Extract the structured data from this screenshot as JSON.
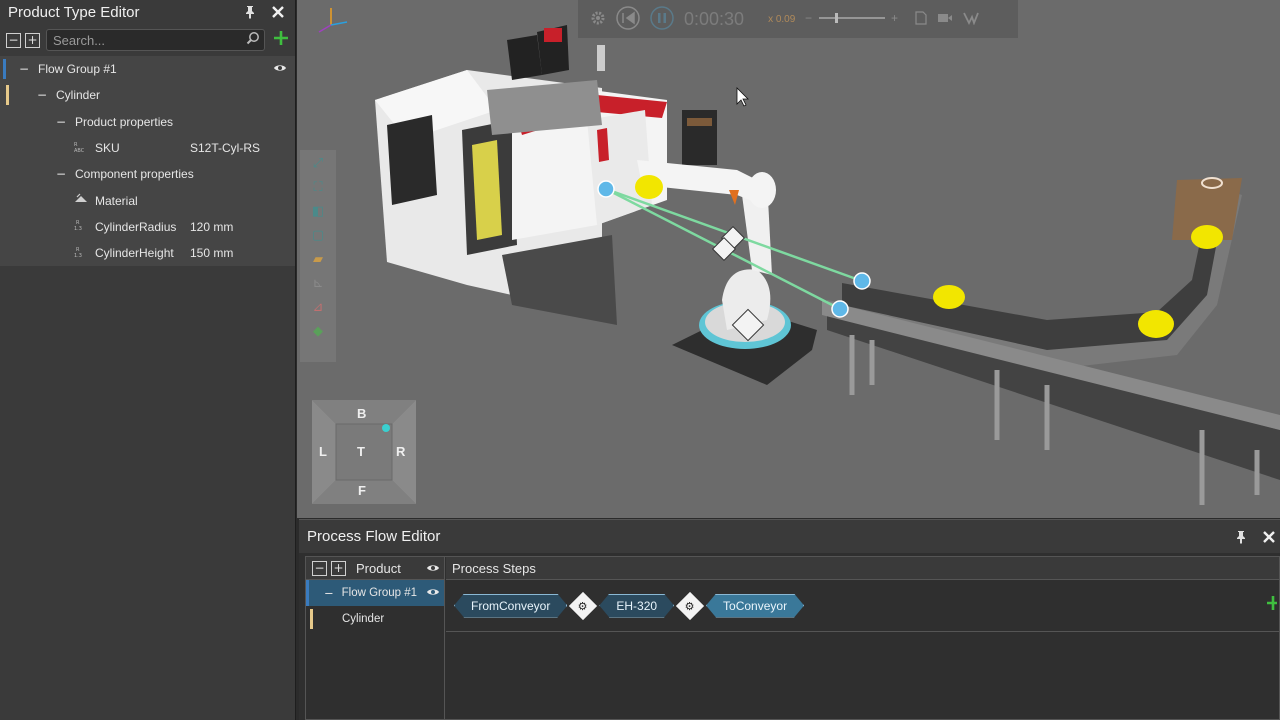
{
  "product_type_editor": {
    "title": "Product Type Editor",
    "pin_icon": "pin-icon",
    "close_icon": "close-icon",
    "search_placeholder": "Search...",
    "tree": [
      {
        "label": "Flow Group #1",
        "level": 0,
        "value": "",
        "bar_color": "#3a7bbf",
        "eye": true
      },
      {
        "label": "Cylinder",
        "level": 1,
        "value": "",
        "bar_color": "#e6c98a"
      },
      {
        "label": "Product properties",
        "level": 2,
        "value": ""
      },
      {
        "label": "SKU",
        "level": 3,
        "value": "S12T-Cyl-RS",
        "icon": "abc-icon"
      },
      {
        "label": "Component properties",
        "level": 2,
        "value": ""
      },
      {
        "label": "Material",
        "level": 3,
        "value": "",
        "icon": "material-icon"
      },
      {
        "label": "CylinderRadius",
        "level": 3,
        "value": "120 mm",
        "icon": "numeric-icon"
      },
      {
        "label": "CylinderHeight",
        "level": 3,
        "value": "150 mm",
        "icon": "numeric-icon"
      }
    ]
  },
  "playback": {
    "time": "0:00:30",
    "speed": "x 0.09"
  },
  "navcube": {
    "top": "B",
    "left": "L",
    "center": "T",
    "right": "R",
    "bottom": "F"
  },
  "process_flow_editor": {
    "title": "Process Flow Editor",
    "product_header": "Product",
    "steps_header": "Process Steps",
    "products": [
      {
        "label": "Flow Group #1",
        "selected": true
      },
      {
        "label": "Cylinder",
        "selected": false
      }
    ],
    "steps": [
      {
        "label": "FromConveyor",
        "selected": false
      },
      {
        "label": "EH-320",
        "selected": false
      },
      {
        "label": "ToConveyor",
        "selected": true
      }
    ]
  },
  "colors": {
    "accent": "#3a7899",
    "add_green": "#3fbf3f",
    "machine_red": "#c8202a",
    "product_yellow": "#f2e600",
    "path_green": "#7ed9a0"
  }
}
